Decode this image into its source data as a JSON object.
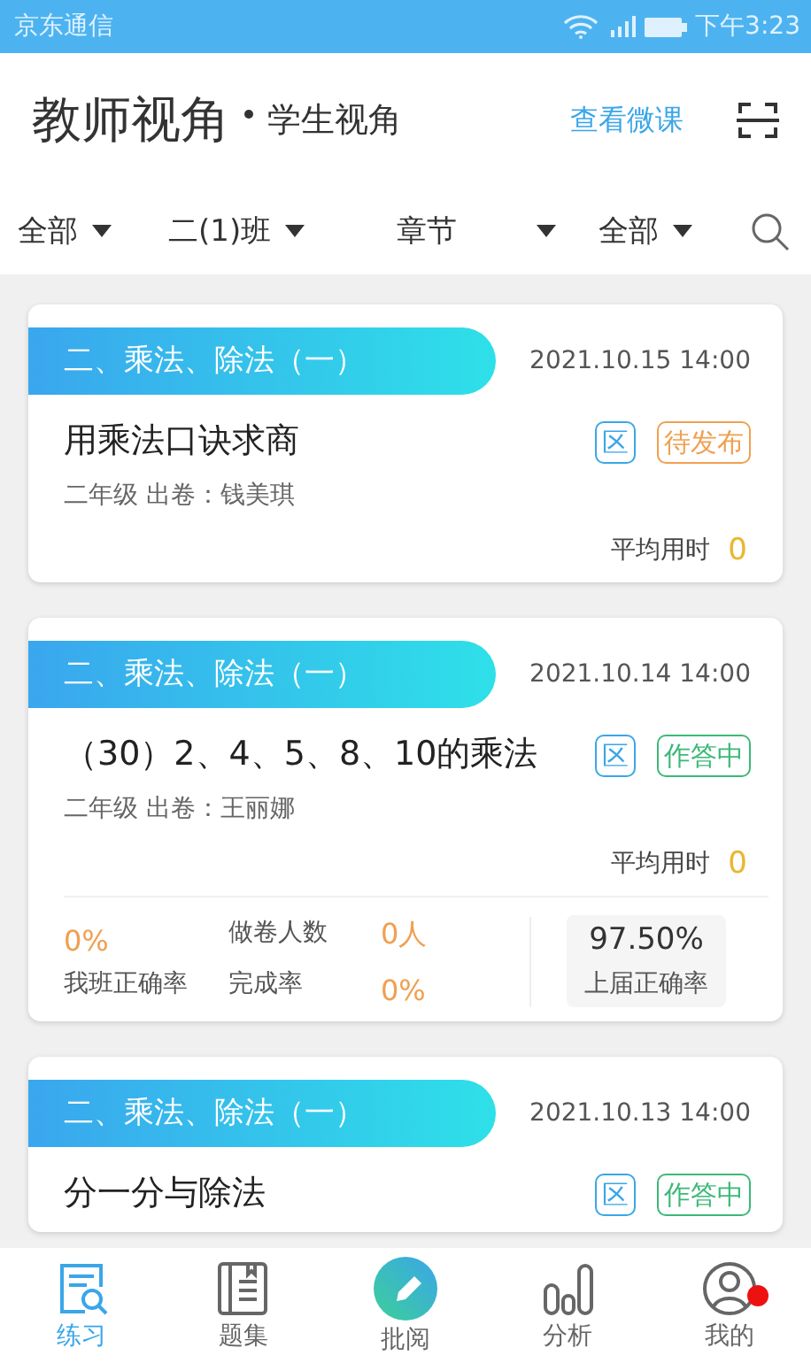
{
  "status_bar": {
    "carrier": "京东通信",
    "time": "下午3:23"
  },
  "header": {
    "views": [
      {
        "label": "教师视角",
        "selected": true
      },
      {
        "label": "学生视角",
        "selected": false
      }
    ],
    "link": "查看微课"
  },
  "filters": [
    "全部",
    "二(1)班",
    "章节",
    "全部"
  ],
  "cards": [
    {
      "chapter": "二、乘法、除法（一）",
      "date": "2021.10.15 14:00",
      "title": "用乘法口诀求商",
      "scope_tag": "区",
      "status": {
        "label": "待发布",
        "color": "#f0a050"
      },
      "meta": "二年级  出卷：钱美琪",
      "avg_label": "平均用时",
      "avg_value": "0"
    },
    {
      "chapter": "二、乘法、除法（一）",
      "date": "2021.10.14 14:00",
      "title": "（30）2、4、5、8、10的乘法",
      "scope_tag": "区",
      "status": {
        "label": "作答中",
        "color": "#3cb878"
      },
      "meta": "二年级  出卷：王丽娜",
      "avg_label": "平均用时",
      "avg_value": "0",
      "stats": {
        "class_rate": "0%",
        "class_rate_label": "我班正确率",
        "takers_label": "做卷人数",
        "takers": "0人",
        "completion_label": "完成率",
        "completion": "0%",
        "prev_rate": "97.50%",
        "prev_rate_label": "上届正确率"
      }
    },
    {
      "chapter": "二、乘法、除法（一）",
      "date": "2021.10.13 14:00",
      "title": "分一分与除法",
      "scope_tag": "区",
      "status": {
        "label": "作答中",
        "color": "#3cb878"
      }
    }
  ],
  "tabs": [
    {
      "label": "练习",
      "kind": "practice",
      "selected": true
    },
    {
      "label": "题集",
      "kind": "book",
      "selected": false
    },
    {
      "label": "批阅",
      "kind": "review",
      "selected": false
    },
    {
      "label": "分析",
      "kind": "chart",
      "selected": false
    },
    {
      "label": "我的",
      "kind": "profile",
      "selected": false,
      "badge": true
    }
  ]
}
